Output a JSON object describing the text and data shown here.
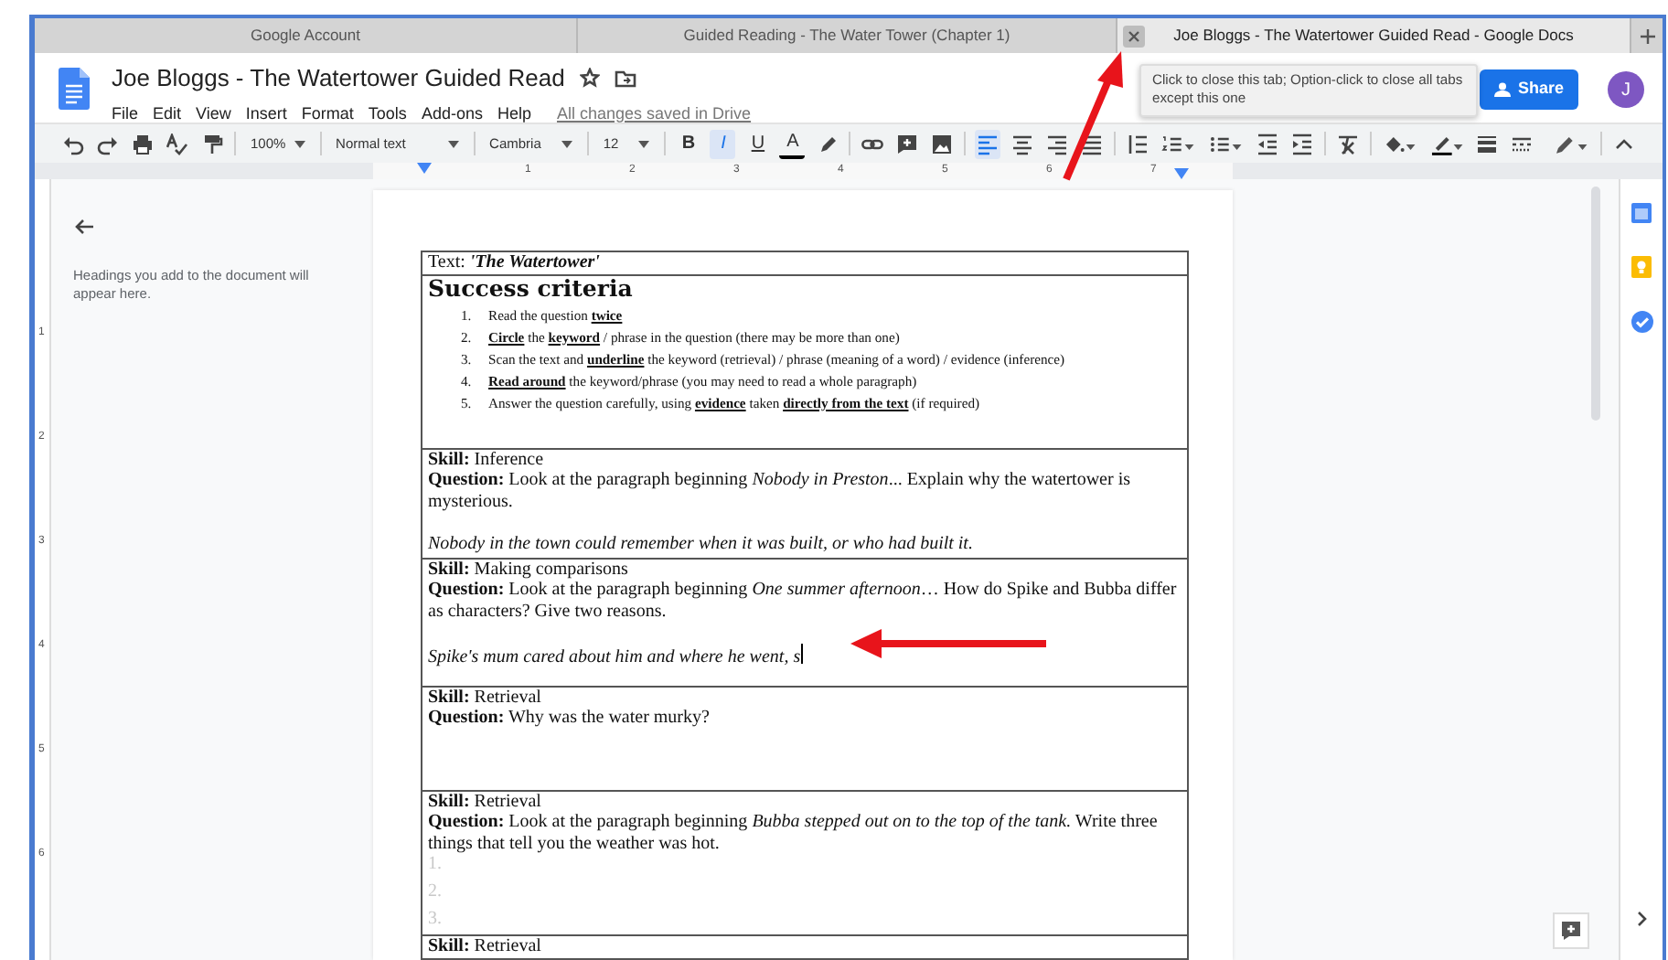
{
  "browser_tabs": [
    {
      "title": "Google Account",
      "selected": false
    },
    {
      "title": "Guided Reading - The Water Tower (Chapter 1)",
      "selected": false
    },
    {
      "title": "Joe Bloggs - The Watertower Guided Read - Google Docs",
      "selected": true
    }
  ],
  "tooltip": "Click to close this tab; Option-click to close all tabs except this one",
  "doc_header": {
    "title": "Joe Bloggs - The Watertower Guided Read",
    "menus": [
      "File",
      "Edit",
      "View",
      "Insert",
      "Format",
      "Tools",
      "Add-ons",
      "Help"
    ],
    "save_status": "All changes saved in Drive",
    "share_label": "Share",
    "avatar_initial": "J"
  },
  "toolbar": {
    "zoom": "100%",
    "style": "Normal text",
    "font": "Cambria",
    "font_size": "12",
    "align_buttons": [
      {
        "kind": "left",
        "selected": true
      },
      {
        "kind": "center",
        "selected": false
      },
      {
        "kind": "right",
        "selected": false
      },
      {
        "kind": "justify",
        "selected": false
      }
    ],
    "format_buttons": [
      {
        "kind": "bold",
        "label": "B",
        "active": false
      },
      {
        "kind": "italic",
        "label": "I",
        "active": true
      },
      {
        "kind": "underline",
        "label": "U",
        "active": false
      },
      {
        "kind": "text-color",
        "label": "A",
        "active": false
      }
    ]
  },
  "ruler": {
    "marks": [
      "1",
      "2",
      "3",
      "4",
      "5",
      "6",
      "7"
    ]
  },
  "vertical_ruler": {
    "marks": [
      "1",
      "2",
      "3",
      "4",
      "5",
      "6"
    ]
  },
  "outline": {
    "hint": "Headings you add to the document will appear here."
  },
  "document": {
    "rows": [
      {
        "kind": "text",
        "label": "Text:",
        "title": "'The Watertower'"
      },
      {
        "kind": "criteria",
        "heading": "Success criteria",
        "items": [
          {
            "number": "1.",
            "text": "Read the question **twice**"
          },
          {
            "number": "2.",
            "text": "**Circle** the **keyword** / phrase in the question (there may be more than one)"
          },
          {
            "number": "3.",
            "text": "Scan the text and **underline** the keyword (retrieval) / phrase (meaning of a word) / evidence (inference)"
          },
          {
            "number": "4.",
            "text": "**Read around** the keyword/phrase (you may need to read a whole paragraph)"
          },
          {
            "number": "5.",
            "text": "Answer the question carefully, using **evidence** taken **directly from the text** (if required)"
          }
        ]
      },
      {
        "kind": "skill",
        "skill": "**Skill:** Inference",
        "question": "**Question:** Look at the paragraph beginning *Nobody in Preston*... Explain why the watertower is mysterious.",
        "answer": "Nobody in the town could remember when it was built, or who had built it.",
        "answer_lines": []
      },
      {
        "kind": "skill",
        "skill": "**Skill:** Making comparisons",
        "question": "**Question:** Look at the paragraph beginning *One summer afternoon*… How do Spike and Bubba differ as characters? Give two reasons.",
        "answer": "Spike's mum cared about him and where he went, s",
        "cursor": true,
        "answer_lines": []
      },
      {
        "kind": "skill",
        "skill": "**Skill:** Retrieval",
        "question": "**Question:** Why was the water murky?",
        "answer_lines": []
      },
      {
        "kind": "skill",
        "skill": "**Skill:** Retrieval",
        "question": "**Question:** Look at the paragraph beginning *Bubba stepped out on to the top of the tank.* Write three things that tell you the weather was hot.",
        "answer_lines": [
          "1.",
          "2.",
          "3."
        ]
      },
      {
        "kind": "skill",
        "skill": "**Skill:** Retrieval",
        "answer_lines": []
      }
    ]
  }
}
